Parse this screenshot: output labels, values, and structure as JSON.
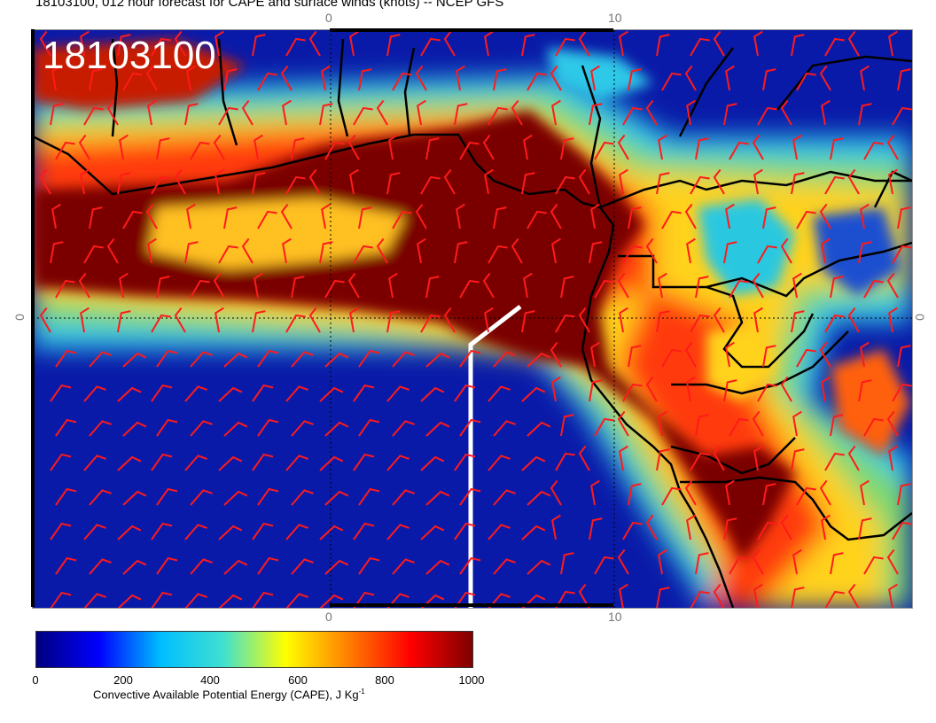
{
  "title": "18103100, 012 hour forecast for CAPE and surface winds (knots) -- NCEP GFS",
  "stamp": "18103100",
  "tick_labels": {
    "top_0": "0",
    "top_10": "10",
    "bottom_0": "0",
    "bottom_10": "10",
    "left_0": "0",
    "right_0": "0"
  },
  "colorbar": {
    "labels": [
      "0",
      "200",
      "400",
      "600",
      "800",
      "1000"
    ],
    "title": "Convective Available Potential Energy (CAPE), J Kg",
    "title_sup": "-1",
    "colors": [
      "#00007f",
      "#0000ff",
      "#00bfff",
      "#40e0d0",
      "#ffff00",
      "#ff8000",
      "#ff0000",
      "#7f0000"
    ]
  },
  "colors": {
    "ocean_cape": "#0a1aa8",
    "high_cape": "#7a0000",
    "wind_barb": "#ff1a1a",
    "coastline": "#000000",
    "transect": "#ffffff"
  }
}
